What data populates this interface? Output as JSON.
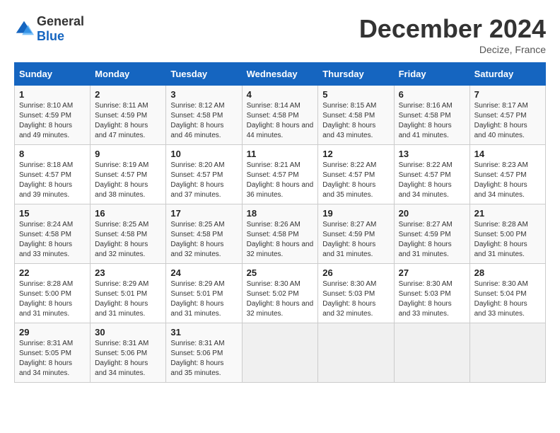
{
  "header": {
    "logo_general": "General",
    "logo_blue": "Blue",
    "month_title": "December 2024",
    "location": "Decize, France"
  },
  "weekdays": [
    "Sunday",
    "Monday",
    "Tuesday",
    "Wednesday",
    "Thursday",
    "Friday",
    "Saturday"
  ],
  "weeks": [
    [
      {
        "day": "1",
        "sunrise": "8:10 AM",
        "sunset": "4:59 PM",
        "daylight": "8 hours and 49 minutes."
      },
      {
        "day": "2",
        "sunrise": "8:11 AM",
        "sunset": "4:59 PM",
        "daylight": "8 hours and 47 minutes."
      },
      {
        "day": "3",
        "sunrise": "8:12 AM",
        "sunset": "4:58 PM",
        "daylight": "8 hours and 46 minutes."
      },
      {
        "day": "4",
        "sunrise": "8:14 AM",
        "sunset": "4:58 PM",
        "daylight": "8 hours and 44 minutes."
      },
      {
        "day": "5",
        "sunrise": "8:15 AM",
        "sunset": "4:58 PM",
        "daylight": "8 hours and 43 minutes."
      },
      {
        "day": "6",
        "sunrise": "8:16 AM",
        "sunset": "4:58 PM",
        "daylight": "8 hours and 41 minutes."
      },
      {
        "day": "7",
        "sunrise": "8:17 AM",
        "sunset": "4:57 PM",
        "daylight": "8 hours and 40 minutes."
      }
    ],
    [
      {
        "day": "8",
        "sunrise": "8:18 AM",
        "sunset": "4:57 PM",
        "daylight": "8 hours and 39 minutes."
      },
      {
        "day": "9",
        "sunrise": "8:19 AM",
        "sunset": "4:57 PM",
        "daylight": "8 hours and 38 minutes."
      },
      {
        "day": "10",
        "sunrise": "8:20 AM",
        "sunset": "4:57 PM",
        "daylight": "8 hours and 37 minutes."
      },
      {
        "day": "11",
        "sunrise": "8:21 AM",
        "sunset": "4:57 PM",
        "daylight": "8 hours and 36 minutes."
      },
      {
        "day": "12",
        "sunrise": "8:22 AM",
        "sunset": "4:57 PM",
        "daylight": "8 hours and 35 minutes."
      },
      {
        "day": "13",
        "sunrise": "8:22 AM",
        "sunset": "4:57 PM",
        "daylight": "8 hours and 34 minutes."
      },
      {
        "day": "14",
        "sunrise": "8:23 AM",
        "sunset": "4:57 PM",
        "daylight": "8 hours and 34 minutes."
      }
    ],
    [
      {
        "day": "15",
        "sunrise": "8:24 AM",
        "sunset": "4:58 PM",
        "daylight": "8 hours and 33 minutes."
      },
      {
        "day": "16",
        "sunrise": "8:25 AM",
        "sunset": "4:58 PM",
        "daylight": "8 hours and 32 minutes."
      },
      {
        "day": "17",
        "sunrise": "8:25 AM",
        "sunset": "4:58 PM",
        "daylight": "8 hours and 32 minutes."
      },
      {
        "day": "18",
        "sunrise": "8:26 AM",
        "sunset": "4:58 PM",
        "daylight": "8 hours and 32 minutes."
      },
      {
        "day": "19",
        "sunrise": "8:27 AM",
        "sunset": "4:59 PM",
        "daylight": "8 hours and 31 minutes."
      },
      {
        "day": "20",
        "sunrise": "8:27 AM",
        "sunset": "4:59 PM",
        "daylight": "8 hours and 31 minutes."
      },
      {
        "day": "21",
        "sunrise": "8:28 AM",
        "sunset": "5:00 PM",
        "daylight": "8 hours and 31 minutes."
      }
    ],
    [
      {
        "day": "22",
        "sunrise": "8:28 AM",
        "sunset": "5:00 PM",
        "daylight": "8 hours and 31 minutes."
      },
      {
        "day": "23",
        "sunrise": "8:29 AM",
        "sunset": "5:01 PM",
        "daylight": "8 hours and 31 minutes."
      },
      {
        "day": "24",
        "sunrise": "8:29 AM",
        "sunset": "5:01 PM",
        "daylight": "8 hours and 31 minutes."
      },
      {
        "day": "25",
        "sunrise": "8:30 AM",
        "sunset": "5:02 PM",
        "daylight": "8 hours and 32 minutes."
      },
      {
        "day": "26",
        "sunrise": "8:30 AM",
        "sunset": "5:03 PM",
        "daylight": "8 hours and 32 minutes."
      },
      {
        "day": "27",
        "sunrise": "8:30 AM",
        "sunset": "5:03 PM",
        "daylight": "8 hours and 33 minutes."
      },
      {
        "day": "28",
        "sunrise": "8:30 AM",
        "sunset": "5:04 PM",
        "daylight": "8 hours and 33 minutes."
      }
    ],
    [
      {
        "day": "29",
        "sunrise": "8:31 AM",
        "sunset": "5:05 PM",
        "daylight": "8 hours and 34 minutes."
      },
      {
        "day": "30",
        "sunrise": "8:31 AM",
        "sunset": "5:06 PM",
        "daylight": "8 hours and 34 minutes."
      },
      {
        "day": "31",
        "sunrise": "8:31 AM",
        "sunset": "5:06 PM",
        "daylight": "8 hours and 35 minutes."
      },
      null,
      null,
      null,
      null
    ]
  ]
}
